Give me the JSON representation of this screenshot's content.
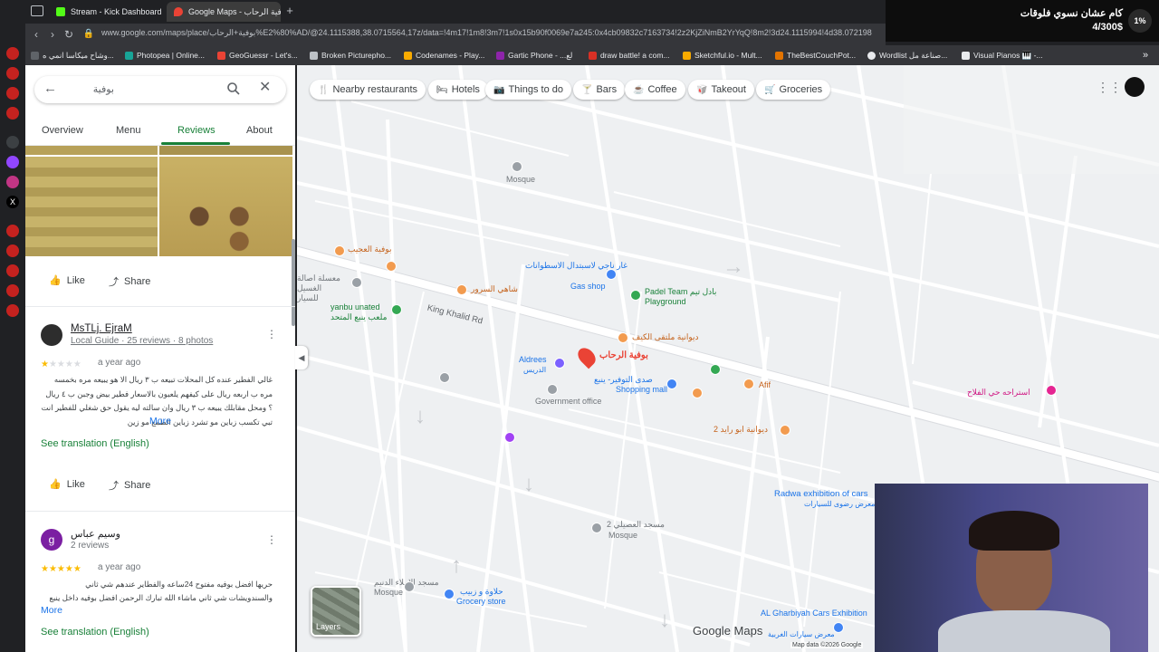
{
  "browser": {
    "tabs": [
      {
        "label": "Stream - Kick Dashboard",
        "active": false,
        "color": "#53fc18"
      },
      {
        "label": "Google Maps - بوفية الرحاب",
        "active": true,
        "color": "#ea4335"
      }
    ],
    "new_tab": "+",
    "url": "www.google.com/maps/place/بوفية+الرحاب%E2%80%AD/@24.1115388,38.0715564,17z/data=!4m17!1m8!3m7!1s0x15b90f0069e7a245:0x4cb09832c7163734!2z2KjZiNmB2YrYqQ!8m2!3d24.1115994!4d38.072198",
    "bookmarks": [
      {
        "label": "وشاح ميكاسا انمي ه...",
        "color": "#5f6368"
      },
      {
        "label": "Photopea | Online...",
        "color": "#18a497"
      },
      {
        "label": "GeoGuessr - Let's...",
        "color": "#ea4335"
      },
      {
        "label": "Broken Picturepho...",
        "color": "#bdc1c6"
      },
      {
        "label": "Codenames - Play...",
        "color": "#f9ab00"
      },
      {
        "label": "Gartic Phone - ...لع",
        "color": "#8e24aa"
      },
      {
        "label": "draw battle! a com...",
        "color": "#d93025"
      },
      {
        "label": "Sketchful.io - Mult...",
        "color": "#f9ab00"
      },
      {
        "label": "TheBestCouchPot...",
        "color": "#e37400"
      },
      {
        "label": "Wordlist صناعة مل...",
        "color": "#e8eaed"
      },
      {
        "label": "Visual Pianos 🎹 -...",
        "color": "#e8eaed"
      }
    ]
  },
  "overlay": {
    "percent": "1%",
    "title": "كام عشان نسوي فلوقات",
    "goal": "4/300$"
  },
  "search": {
    "query": "بوفية"
  },
  "panel": {
    "tabs": [
      "Overview",
      "Menu",
      "Reviews",
      "About"
    ],
    "active_tab": "Reviews",
    "like_label": "Like",
    "share_label": "Share",
    "reviews": [
      {
        "author": "MsTLj. EjraM",
        "meta": "Local Guide · 25 reviews · 8 photos",
        "rating": 1,
        "time": "a year ago",
        "text": "غالي الفطير عنده كل المحلات تبيعه ب ٣ ريال الا هو يبيعه مره بخمسه مره ب اربعه ريال على كيفهم يلعبون بالاسعار فطير بيض وجبن ب ٤ ريال ؟ ومحل مقابلك يبيعه ب ٣ ريال وان سالته ليه يقول حق شغلي للفطير انت تبي تكسب زباين مو تشرد زباين الطمع مو زين",
        "more": "More",
        "translate": "See translation (English)",
        "avatar_letter": ""
      },
      {
        "author": "وسيم عباس",
        "meta": "2 reviews",
        "rating": 5,
        "time": "a year ago",
        "text": "حريها افضل بوفيه مفتوح 24ساعه والفطاير عندهم شي ثاني والسندويشات شي ثاني ماشاء الله تبارك الرحمن افضل بوفيه داخل ينبع والاخلاق جميله جدا",
        "more": "More",
        "translate": "See translation (English)",
        "avatar_letter": "g"
      }
    ]
  },
  "map": {
    "chips": [
      {
        "icon": "🍴",
        "label": "Nearby restaurants"
      },
      {
        "icon": "🛏",
        "label": "Hotels"
      },
      {
        "icon": "📷",
        "label": "Things to do"
      },
      {
        "icon": "🍸",
        "label": "Bars"
      },
      {
        "icon": "☕",
        "label": "Coffee"
      },
      {
        "icon": "🥡",
        "label": "Takeout"
      },
      {
        "icon": "🛒",
        "label": "Groceries"
      }
    ],
    "places": [
      {
        "name": "بوفية الرحاب",
        "kind": "selected"
      },
      {
        "name": "Mosque",
        "kind": "gray"
      },
      {
        "name": "بوفية العجيب",
        "kind": "orange"
      },
      {
        "name": "معسلة اصالة الغسيل للسيار",
        "kind": "gray"
      },
      {
        "name": "غار ناجي لاسبتدال الاسطوانات",
        "kind": "blue"
      },
      {
        "name": "Gas shop",
        "kind": "blue"
      },
      {
        "name": "شاهي السرور",
        "kind": "orange"
      },
      {
        "name": "Padel Team بادل تيم",
        "kind": "green"
      },
      {
        "name": "Playground",
        "kind": "green"
      },
      {
        "name": "yanbu unated",
        "kind": "green"
      },
      {
        "name": "ملعب ينبع المتحد",
        "kind": "green"
      },
      {
        "name": "King Khalid Rd",
        "kind": "road"
      },
      {
        "name": "ديوانية ملتقى الكيف",
        "kind": "orange"
      },
      {
        "name": "Aldrees",
        "kind": "blue"
      },
      {
        "name": "الدريس",
        "kind": "blue"
      },
      {
        "name": "صدى التوفير- ينبع",
        "kind": "blue"
      },
      {
        "name": "Shopping mall",
        "kind": "blue"
      },
      {
        "name": "Government office",
        "kind": "gray"
      },
      {
        "name": "Afif",
        "kind": "orange"
      },
      {
        "name": "ديوانية ابو رايد 2",
        "kind": "orange"
      },
      {
        "name": "استراحه حي الفلاح",
        "kind": "pink"
      },
      {
        "name": "Radwa exhibition of cars",
        "kind": "blue"
      },
      {
        "name": "معرض رضوى للسيارات",
        "kind": "blue"
      },
      {
        "name": "مسجد العصيلي 2",
        "kind": "gray"
      },
      {
        "name": "Mosque",
        "kind": "gray"
      },
      {
        "name": "حلاوة و زبيب",
        "kind": "blue"
      },
      {
        "name": "Grocery store",
        "kind": "blue"
      },
      {
        "name": "مسجد الاملاء الدنيم",
        "kind": "gray"
      },
      {
        "name": "Mosque",
        "kind": "gray"
      },
      {
        "name": "AL Gharbiyah Cars Exhibition",
        "kind": "blue"
      },
      {
        "name": "معرض سيارات الغربية",
        "kind": "blue"
      }
    ],
    "layers_label": "Layers",
    "logo": "Google Maps",
    "attribution": "Map data ©2026 Google"
  }
}
